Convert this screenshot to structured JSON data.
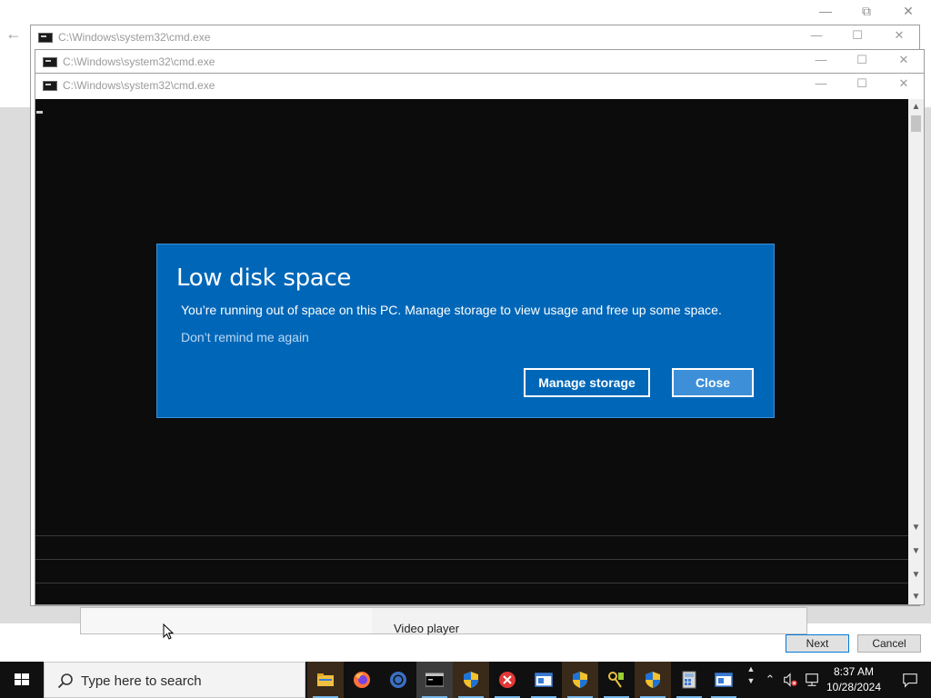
{
  "background_window": {
    "list_item": "Video player",
    "next_label": "Next",
    "cancel_label": "Cancel"
  },
  "cmd_windows": [
    {
      "title": "C:\\Windows\\system32\\cmd.exe"
    },
    {
      "title": "C:\\Windows\\system32\\cmd.exe"
    },
    {
      "title": "C:\\Windows\\system32\\cmd.exe"
    }
  ],
  "dialog": {
    "title": "Low disk space",
    "message": "You’re running out of space on this PC. Manage storage to view usage and free up some space.",
    "dont_remind": "Don’t remind me again",
    "manage_label": "Manage storage",
    "close_label": "Close"
  },
  "taskbar": {
    "search_placeholder": "Type here to search",
    "time": "8:37 AM",
    "date": "10/28/2024",
    "apps": [
      "file-explorer-icon",
      "firefox-icon",
      "chrome-icon",
      "cmd-icon",
      "uac-shield-icon",
      "error-icon",
      "window-icon",
      "uac-shield-icon",
      "key-tool-icon",
      "uac-shield-icon",
      "calculator-icon",
      "window-icon"
    ]
  },
  "colors": {
    "dialog_blue": "#0067b8",
    "console_black": "#0c0c0c",
    "taskbar": "#101010"
  }
}
